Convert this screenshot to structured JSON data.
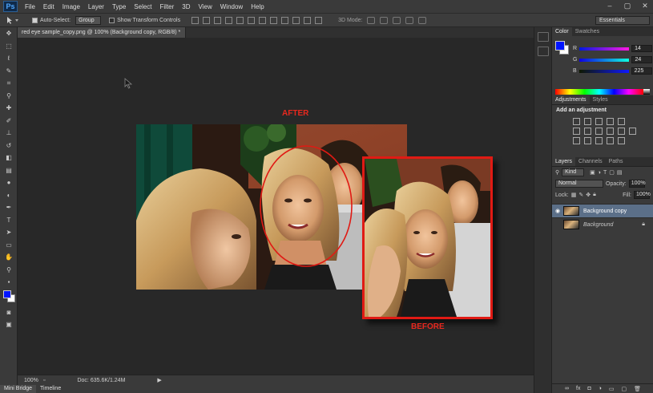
{
  "app": {
    "logo": "Ps"
  },
  "menu": [
    "File",
    "Edit",
    "Image",
    "Layer",
    "Type",
    "Select",
    "Filter",
    "3D",
    "View",
    "Window",
    "Help"
  ],
  "window_controls": [
    "–",
    "▢",
    "✕"
  ],
  "options": {
    "auto_select_label": "Auto-Select:",
    "auto_select_value": "Group",
    "transform_label": "Show Transform Controls",
    "mode3d_label": "3D Mode:",
    "workspace": "Essentials"
  },
  "document": {
    "tab_title": "red eye sample_copy.png @ 100% (Background copy, RGB/8) *",
    "after_label": "AFTER",
    "before_label": "BEFORE"
  },
  "status": {
    "zoom": "100%",
    "doc_info": "Doc: 635.6K/1.24M",
    "arrow": "▶"
  },
  "bottom_tabs": [
    "Mini Bridge",
    "Timeline"
  ],
  "color_panel": {
    "tabs": [
      "Color",
      "Swatches"
    ],
    "r_label": "R",
    "r_value": "14",
    "g_label": "G",
    "g_value": "24",
    "b_label": "B",
    "b_value": "225",
    "foreground": "#0015ff",
    "background": "#ffffff"
  },
  "adjustments_panel": {
    "tabs": [
      "Adjustments",
      "Styles"
    ],
    "title": "Add an adjustment"
  },
  "layers_panel": {
    "tabs": [
      "Layers",
      "Channels",
      "Paths"
    ],
    "filter": "Kind",
    "blend_mode": "Normal",
    "opacity_label": "Opacity:",
    "opacity_value": "100%",
    "lock_label": "Lock:",
    "fill_label": "Fill:",
    "fill_value": "100%",
    "layers": [
      {
        "name": "Background copy",
        "selected": true,
        "visible": true
      },
      {
        "name": "Background",
        "selected": false,
        "visible": false,
        "locked": true
      }
    ],
    "footer_icons": [
      "link-icon",
      "fx-icon",
      "mask-icon",
      "adjustment-icon",
      "folder-icon",
      "new-layer-icon",
      "trash-icon"
    ]
  },
  "colors": {
    "accent_red": "#e8281e",
    "selected_layer": "#5b6f88"
  }
}
